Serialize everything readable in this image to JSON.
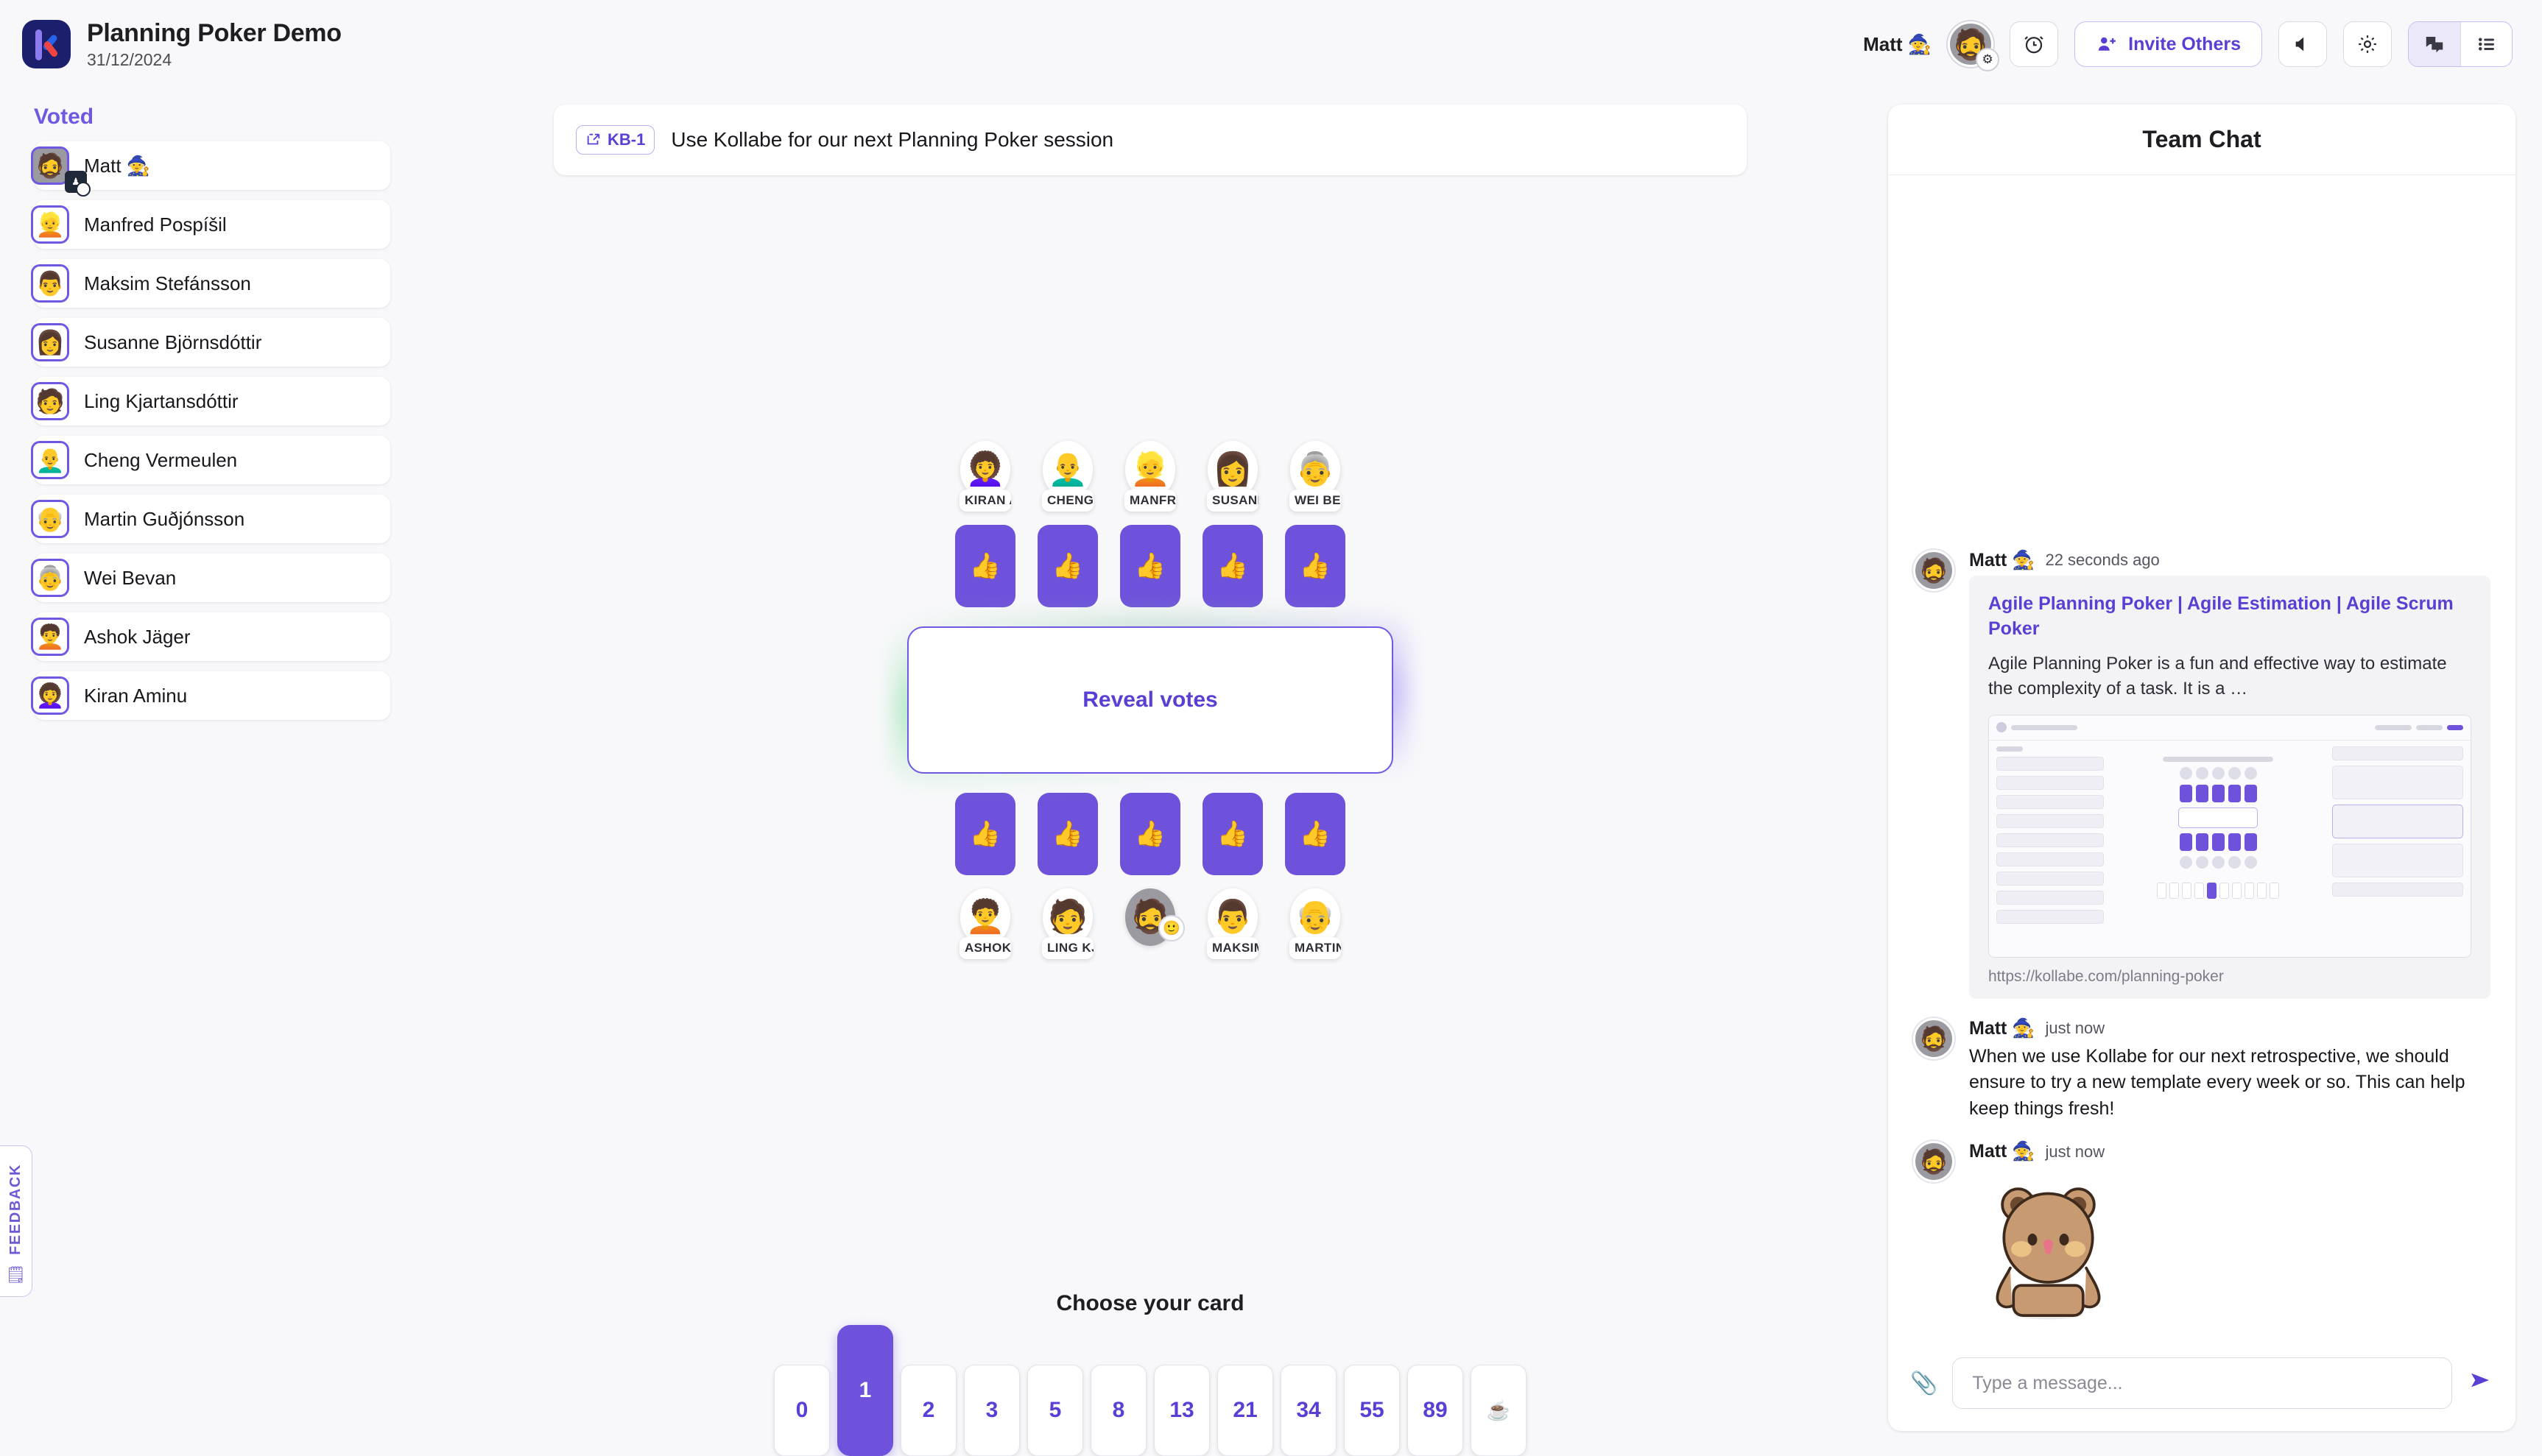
{
  "header": {
    "app_title": "Planning Poker Demo",
    "date": "31/12/2024",
    "logo_name": "kollabe-logo",
    "user_name": "Matt 🧙",
    "avatar_badge_icon": "gear-icon",
    "timer_icon": "alarm-clock-icon",
    "invite_label": "Invite Others",
    "invite_icon": "add-person-icon",
    "sound_icon": "speaker-icon",
    "settings_icon": "gear-icon",
    "chat_toggle_icon": "chat-bubbles-icon",
    "backlog_toggle_icon": "list-icon"
  },
  "sidebar": {
    "title": "Voted",
    "feedback_label": "FEEDBACK",
    "feedback_icon": "megaphone-icon",
    "voters": [
      {
        "name": "Matt 🧙",
        "emoji": "🧔",
        "photo": true,
        "host": true
      },
      {
        "name": "Manfred Pospíšil",
        "emoji": "👱",
        "photo": false,
        "host": false
      },
      {
        "name": "Maksim Stefánsson",
        "emoji": "👨",
        "photo": false,
        "host": false
      },
      {
        "name": "Susanne Björnsdóttir",
        "emoji": "👩",
        "photo": false,
        "host": false
      },
      {
        "name": "Ling Kjartansdóttir",
        "emoji": "🧑",
        "photo": false,
        "host": false
      },
      {
        "name": "Cheng Vermeulen",
        "emoji": "👨‍🦲",
        "photo": false,
        "host": false
      },
      {
        "name": "Martin Guðjónsson",
        "emoji": "👴",
        "photo": false,
        "host": false
      },
      {
        "name": "Wei Bevan",
        "emoji": "👵",
        "photo": false,
        "host": false
      },
      {
        "name": "Ashok Jäger",
        "emoji": "🧑‍🦱",
        "photo": false,
        "host": false
      },
      {
        "name": "Kiran Aminu",
        "emoji": "👩‍🦱",
        "photo": false,
        "host": false
      }
    ]
  },
  "story": {
    "key": "KB-1",
    "link_icon": "external-link-icon",
    "title": "Use Kollabe for our next Planning Poker session"
  },
  "table": {
    "reveal_label": "Reveal votes",
    "vote_card_emoji": "👍",
    "top_seats": [
      {
        "label": "KIRAN A",
        "emoji": "👩‍🦱",
        "photo": false
      },
      {
        "label": "CHENG",
        "emoji": "👨‍🦲",
        "photo": false
      },
      {
        "label": "MANFRI",
        "emoji": "👱",
        "photo": false
      },
      {
        "label": "SUSANN",
        "emoji": "👩",
        "photo": false
      },
      {
        "label": "WEI BEV",
        "emoji": "👵",
        "photo": false
      }
    ],
    "bottom_seats": [
      {
        "label": "ASHOK",
        "emoji": "🧑‍🦱",
        "photo": false,
        "emoji_button": false
      },
      {
        "label": "LING KJ",
        "emoji": "🧑",
        "photo": false,
        "emoji_button": false
      },
      {
        "label": "",
        "emoji": "🧔",
        "photo": true,
        "emoji_button": true
      },
      {
        "label": "MAKSIM",
        "emoji": "👨",
        "photo": false,
        "emoji_button": false
      },
      {
        "label": "MARTIN",
        "emoji": "👴",
        "photo": false,
        "emoji_button": false
      }
    ],
    "emoji_button_icon": "add-reaction-icon"
  },
  "deck": {
    "label": "Choose your card",
    "cards": [
      "0",
      "1",
      "2",
      "3",
      "5",
      "8",
      "13",
      "21",
      "34",
      "55",
      "89",
      "☕"
    ],
    "selected": "1"
  },
  "chat": {
    "title": "Team Chat",
    "messages": [
      {
        "author": "Matt 🧙",
        "time": "22 seconds ago",
        "avatar_emoji": "🧔",
        "type": "link_preview",
        "preview": {
          "title": "Agile Planning Poker | Agile Estimation | Agile Scrum Poker",
          "description": "Agile Planning Poker is a fun and effective way to estimate the complexity of a task. It is a …",
          "url": "https://kollabe.com/planning-poker",
          "thumb_name": "kollabe-app-screenshot-thumbnail"
        }
      },
      {
        "author": "Matt 🧙",
        "time": "just now",
        "avatar_emoji": "🧔",
        "type": "text",
        "text": "When we use Kollabe for our next retrospective, we should ensure to try a new template every week or so. This can help keep things fresh!"
      },
      {
        "author": "Matt 🧙",
        "time": "just now",
        "avatar_emoji": "🧔",
        "type": "sticker",
        "sticker_name": "brown-bear-sticker"
      }
    ],
    "input_placeholder": "Type a message...",
    "input_value": "",
    "attach_icon": "paperclip-icon",
    "send_icon": "send-icon"
  },
  "colors": {
    "accent_purple": "#6f52dc",
    "accent_purple_text": "#5b3fd4",
    "page_bg": "#f8f8fa"
  }
}
